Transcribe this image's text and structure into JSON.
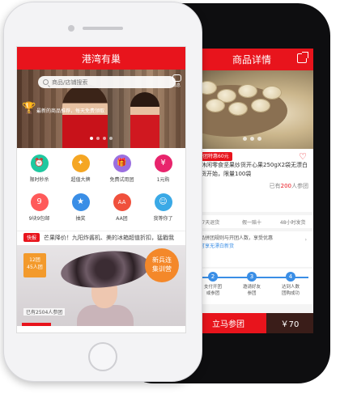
{
  "home_screen": {
    "title": "港湾有巢",
    "search_placeholder": "商品/店铺搜索",
    "message_label": "消息",
    "banner_slogan": "最新的商品推荐，每天免费领取",
    "grid": [
      {
        "label": "限时秒杀",
        "icon": "alarm-icon",
        "color": "#1fc8a0"
      },
      {
        "label": "超值大牌",
        "icon": "brand-icon",
        "color": "#f5a623"
      },
      {
        "label": "免费试用团",
        "icon": "gift-icon",
        "color": "#9b6fe0"
      },
      {
        "label": "1元购",
        "icon": "money-icon",
        "color": "#e8246c"
      },
      {
        "label": "9块9包邮",
        "icon": "price-icon",
        "color": "#ff5a5a"
      },
      {
        "label": "抽奖",
        "icon": "lottery-icon",
        "color": "#3a8ee6"
      },
      {
        "label": "AA团",
        "icon": "aa-icon",
        "color": "#f0503c"
      },
      {
        "label": "我等你了",
        "icon": "user-icon",
        "color": "#3aa9e6"
      }
    ],
    "flash_tag": "快报",
    "flash_text": "芒果降价！九阳炸酱机、美的冰箱超值折扣，猛戳我",
    "product_price_badge": "12团\n45人团",
    "product_new_badge": "新兵连\n集训营",
    "product_joined": "已有2504人参团"
  },
  "detail_screen": {
    "title": "商品详情",
    "tag": "拼团特惠60元",
    "product_title": "产休闲零食坚果炒货开心果250gX2袋无漂白新货开始，限量100袋",
    "joined_prefix": "已有",
    "joined_count": "200",
    "joined_suffix": "人参团",
    "policies": [
      "7天退货",
      "假一赔十",
      "48小时发货"
    ],
    "rule_text": "出品拼团规则与开团人数，享受优惠",
    "rule_link": "即可享无漂白新货",
    "steps": [
      {
        "num": "2",
        "label": "支付开团\n或参团"
      },
      {
        "num": "3",
        "label": "邀请好友\n参团"
      },
      {
        "num": "4",
        "label": "达到人数\n团购成功"
      }
    ],
    "join_button": "立马参团",
    "price": "￥70"
  }
}
